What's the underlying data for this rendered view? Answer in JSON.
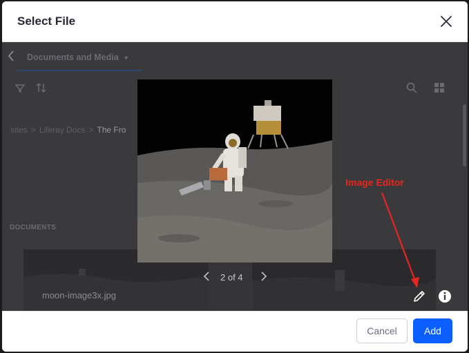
{
  "dialog": {
    "title": "Select File"
  },
  "under_page": {
    "tab_label": "Documents and Media",
    "breadcrumb": [
      "sites",
      "Liferay Docs",
      "The Fro"
    ],
    "section_label": "DOCUMENTS",
    "card_filename": "moon-image3x.jpg"
  },
  "viewer": {
    "pager_text": "2 of 4",
    "image_description_icon": "moon-landing-photo"
  },
  "annotation": {
    "label": "Image Editor",
    "color": "#e8261e"
  },
  "footer": {
    "cancel_label": "Cancel",
    "add_label": "Add"
  },
  "colors": {
    "primary": "#0b5fff",
    "overlay": "#3a3a3c"
  }
}
